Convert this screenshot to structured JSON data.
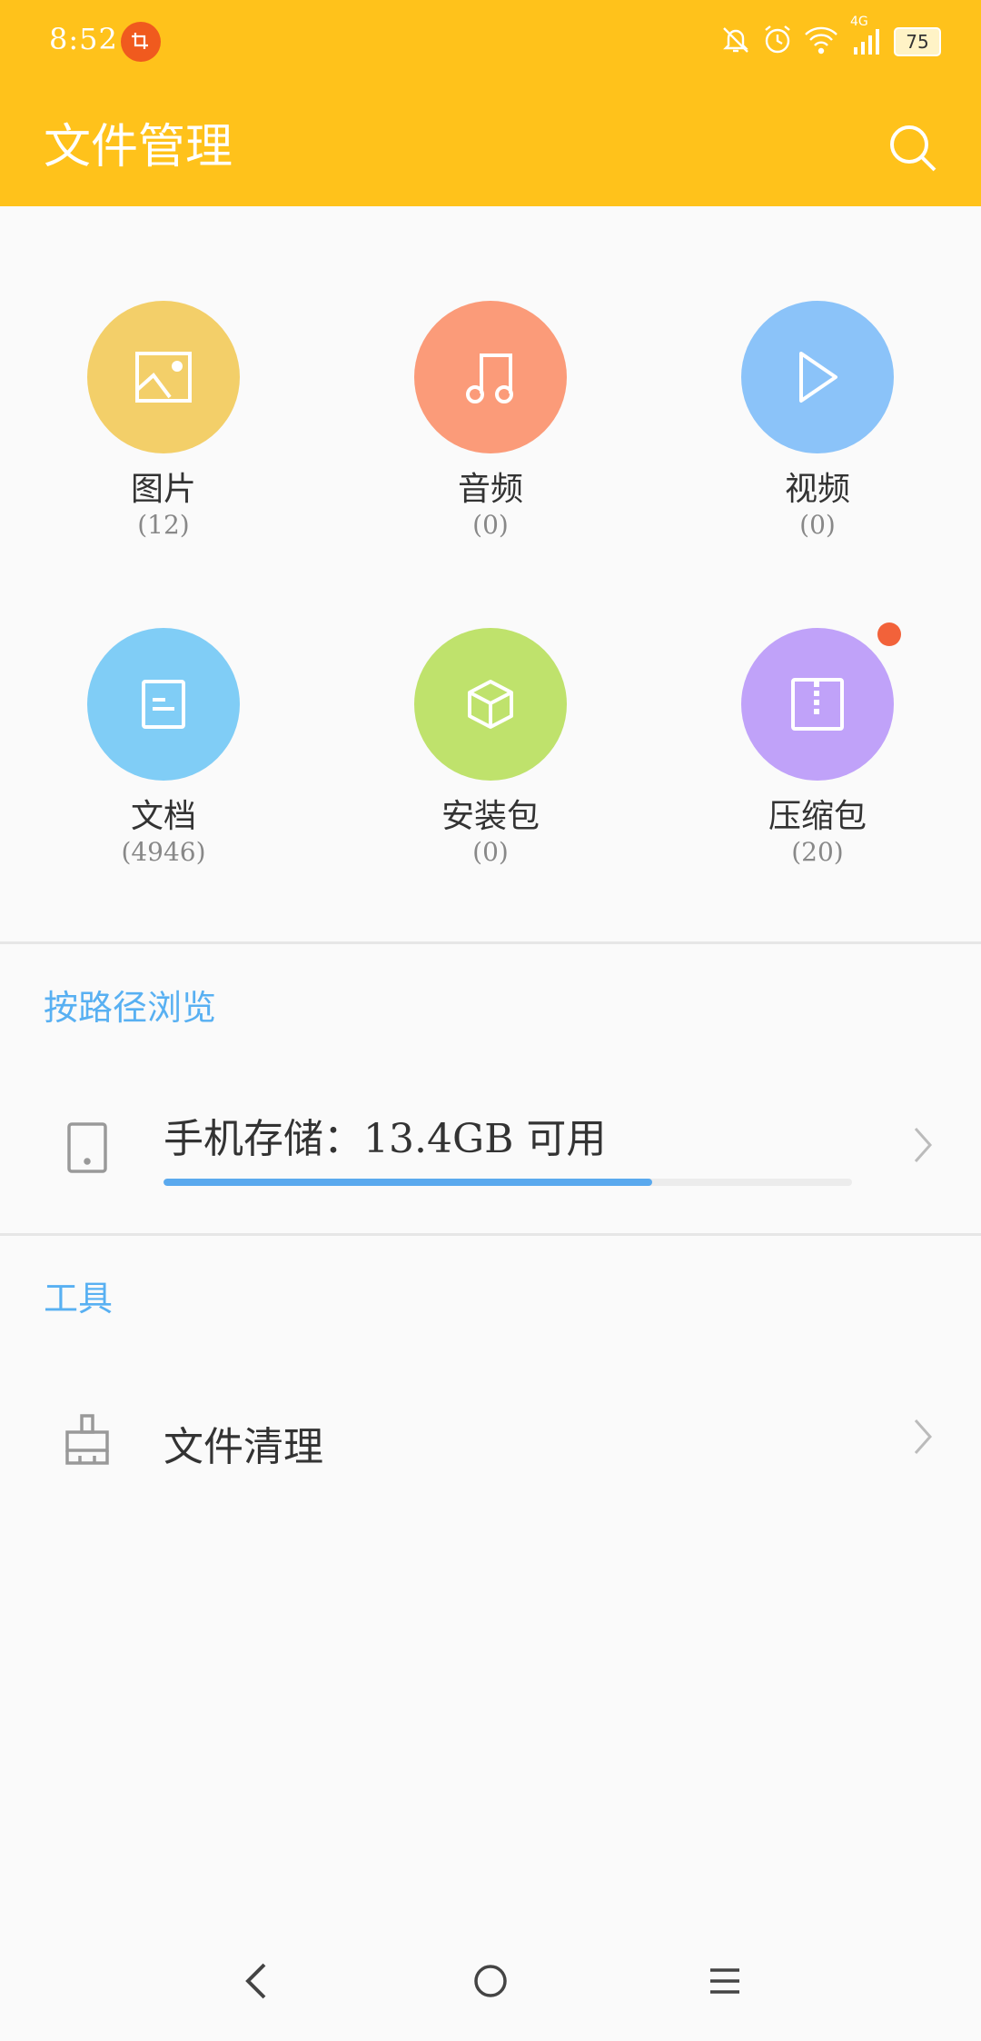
{
  "status_bar": {
    "time": "8:52",
    "battery": "75",
    "network": "4G"
  },
  "header": {
    "title": "文件管理",
    "background_color": "#ffc21b",
    "search_icon": "search-icon"
  },
  "categories": [
    {
      "label": "图片",
      "count": "(12)",
      "icon": "image-icon",
      "color": "#f3cf69"
    },
    {
      "label": "音频",
      "count": "(0)",
      "icon": "music-icon",
      "color": "#fb9b79"
    },
    {
      "label": "视频",
      "count": "(0)",
      "icon": "play-icon",
      "color": "#8bc3f9"
    },
    {
      "label": "文档",
      "count": "(4946)",
      "icon": "document-icon",
      "color": "#80cdf6"
    },
    {
      "label": "安装包",
      "count": "(0)",
      "icon": "package-icon",
      "color": "#bfe26c"
    },
    {
      "label": "压缩包",
      "count": "(20)",
      "icon": "zip-icon",
      "color": "#c0a2f9",
      "has_notification": true
    }
  ],
  "browse_section": {
    "title": "按路径浏览",
    "storage": {
      "label": "手机存储：13.4GB  可用",
      "used_fraction": 0.71
    }
  },
  "tools_section": {
    "title": "工具",
    "items": [
      {
        "label": "文件清理",
        "icon": "broom-icon"
      }
    ]
  },
  "navbar": {
    "items": [
      "back-icon",
      "home-icon",
      "menu-icon"
    ]
  },
  "colors": {
    "accent_blue": "#58b0f2",
    "notification_red": "#f2623a"
  }
}
